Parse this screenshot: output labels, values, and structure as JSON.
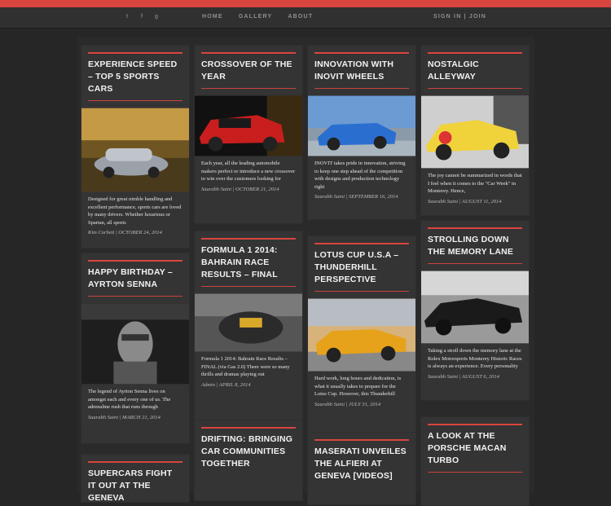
{
  "colors": {
    "accent": "#d9453e",
    "background": "#262626",
    "card": "#343434"
  },
  "nav": {
    "social": [
      {
        "icon": "twitter-icon",
        "glyph": "t"
      },
      {
        "icon": "facebook-icon",
        "glyph": "f"
      },
      {
        "icon": "google-plus-icon",
        "glyph": "g"
      }
    ],
    "links": [
      "HOME",
      "GALLERY",
      "ABOUT"
    ],
    "auth": "SIGN IN | JOIN"
  },
  "cards": [
    {
      "title": "EXPERIENCE SPEED – TOP 5 SPORTS CARS",
      "body": "Designed for great nimble handling and excellent performance, sports cars are loved by many drivers. Whether luxurious or Spartan, all sports",
      "meta": "Kim Corbett | OCTOBER 24, 2014"
    },
    {
      "title": "HAPPY BIRTHDAY – AYRTON SENNA",
      "body": "The legend of Ayrton Senna lives on amongst each and every one of us. The adrenaline rush that runs through",
      "meta": "Saurabh Saini | MARCH 21, 2014"
    },
    {
      "title": "SUPERCARS FIGHT IT OUT AT THE GENEVA",
      "body": "",
      "meta": ""
    },
    {
      "title": "CROSSOVER OF THE YEAR",
      "body": "Each year, all the leading automobile makers perfect or introduce a new crossover to win over the customers looking for",
      "meta": "Saurabh Saini | OCTOBER 21, 2014"
    },
    {
      "title": "FORMULA 1 2014: BAHRAIN RACE RESULTS – FINAL",
      "body": "Formula 1 2014: Bahrain Race Results – FINAL (via Gas 2.0) There were so many thrills and dramas playing out",
      "meta": "Admin | APRIL 8, 2014"
    },
    {
      "title": "DRIFTING: BRINGING CAR COMMUNITIES TOGETHER",
      "body": "",
      "meta": ""
    },
    {
      "title": "INNOVATION WITH INOVIT WHEELS",
      "body": "INOVIT takes pride in innovation, striving to keep one step ahead of the competition with designs and production technology right",
      "meta": "Saurabh Saini | SEPTEMBER 16, 2014"
    },
    {
      "title": "LOTUS CUP U.S.A – THUNDERHILL PERSPECTIVE",
      "body": "Hard work, long hours and dedication, is what it usually takes to prepare for the Lotus Cup. However, this Thunderhill",
      "meta": "Saurabh Saini | JULY 31, 2014"
    },
    {
      "title": "MASERATI UNVEILES THE ALFIERI AT GENEVA [VIDEOS]",
      "body": "",
      "meta": ""
    },
    {
      "title": "NOSTALGIC ALLEYWAY",
      "body": "The joy cannot be summarized in words that I feel when it comes to the \"Car Week\" in Monterey. Hence,",
      "meta": "Saurabh Saini | AUGUST 11, 2014"
    },
    {
      "title": "STROLLING DOWN THE MEMORY LANE",
      "body": "Taking a stroll down the memory lane at the Rolex Motorsports Monterey Historic Races is always an experience. Every personality",
      "meta": "Saurabh Saini | AUGUST 6, 2014"
    },
    {
      "title": "A LOOK AT THE PORSCHE MACAN TURBO",
      "body": "",
      "meta": ""
    }
  ]
}
